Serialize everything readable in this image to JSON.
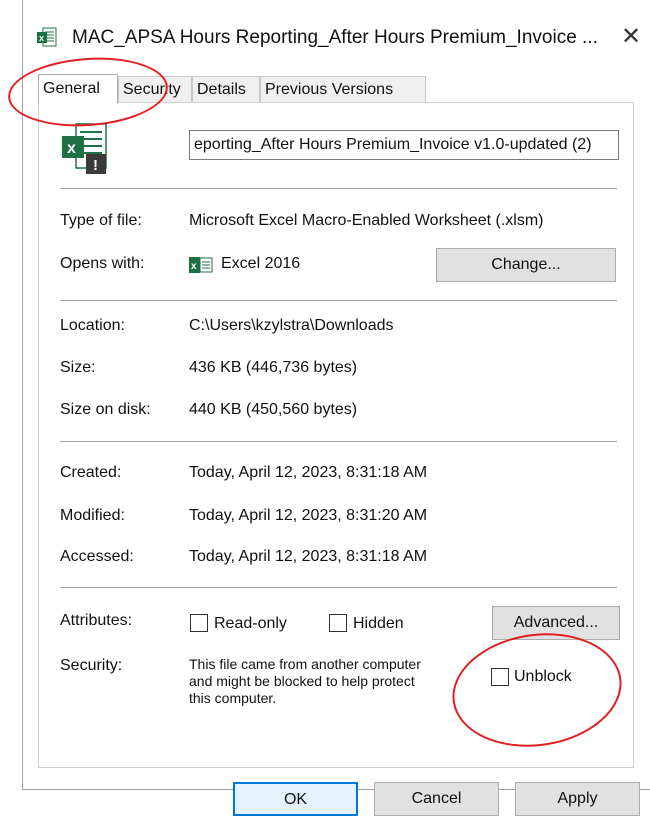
{
  "window": {
    "title": "MAC_APSA Hours Reporting_After Hours Premium_Invoice ...",
    "close_glyph": "✕"
  },
  "tabs": [
    {
      "label": "General",
      "active": true
    },
    {
      "label": "Security",
      "active": false
    },
    {
      "label": "Details",
      "active": false
    },
    {
      "label": "Previous Versions",
      "active": false
    }
  ],
  "general": {
    "filename": "eporting_After Hours Premium_Invoice v1.0-updated (2)",
    "type_label": "Type of file:",
    "type_value": "Microsoft Excel Macro-Enabled Worksheet (.xlsm)",
    "opens_label": "Opens with:",
    "opens_value": "Excel 2016",
    "change_button": "Change...",
    "location_label": "Location:",
    "location_value": "C:\\Users\\kzylstra\\Downloads",
    "size_label": "Size:",
    "size_value": "436 KB (446,736 bytes)",
    "size_disk_label": "Size on disk:",
    "size_disk_value": "440 KB (450,560 bytes)",
    "created_label": "Created:",
    "created_value": "Today, April 12, 2023, 8:31:18 AM",
    "modified_label": "Modified:",
    "modified_value": "Today, April 12, 2023, 8:31:20 AM",
    "accessed_label": "Accessed:",
    "accessed_value": "Today, April 12, 2023, 8:31:18 AM",
    "attributes_label": "Attributes:",
    "readonly_label": "Read-only",
    "hidden_label": "Hidden",
    "advanced_button": "Advanced...",
    "security_label": "Security:",
    "security_lines": [
      "This file came from another computer",
      "and might be blocked to help protect",
      "this computer."
    ],
    "unblock_label": "Unblock",
    "readonly_checked": false,
    "hidden_checked": false,
    "unblock_checked": false
  },
  "footer": {
    "ok": "OK",
    "cancel": "Cancel",
    "apply": "Apply"
  },
  "icons": {
    "title": "excel-file-icon",
    "file": "excel-macro-file-icon",
    "opens_with": "excel-app-icon",
    "close": "close-icon"
  },
  "colors": {
    "excel_green": "#1e7145",
    "annotation_red": "#e02020",
    "ok_border": "#0078d7"
  }
}
